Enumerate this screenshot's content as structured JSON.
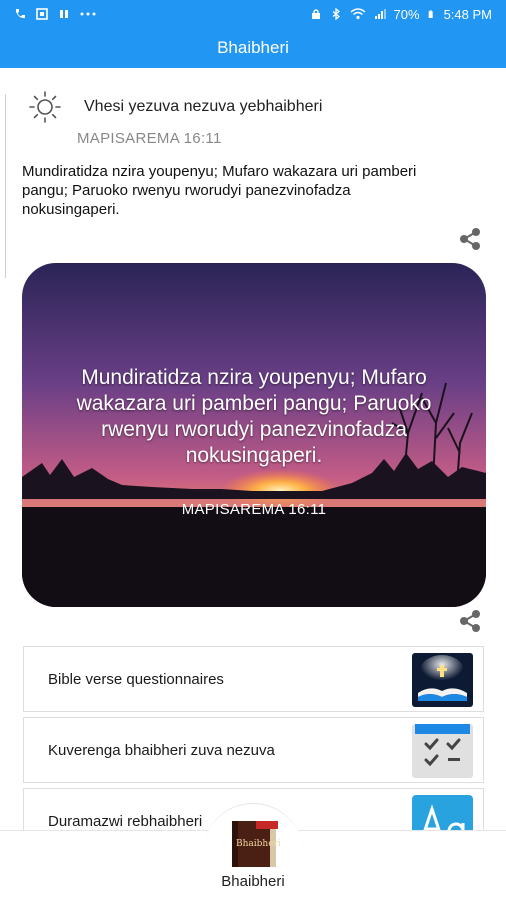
{
  "status_bar": {
    "battery": "70%",
    "time": "5:48 PM",
    "left_icons": [
      "phone-icon",
      "image-icon",
      "pause-icon",
      "more-icon"
    ],
    "right_icons": [
      "lock-icon",
      "bluetooth-icon",
      "wifi-icon",
      "signal-icon",
      "battery-icon"
    ]
  },
  "app_bar": {
    "title": "Bhaibheri",
    "color": "#2196f3"
  },
  "verse_of_day": {
    "title": "Vhesi yezuva nezuva yebhaibheri",
    "reference": "MAPISAREMA 16:11",
    "text": "Mundiratidza nzira youpenyu; Mufaro wakazara uri pamberi pangu; Paruoko rwenyu rworudyi panezvinofadza nokusingaperi."
  },
  "verse_card": {
    "text": "Mundiratidza nzira youpenyu; Mufaro wakazara uri pamberi pangu; Paruoko rwenyu rworudyi panezvinofadza nokusingaperi.",
    "reference": "MAPISAREMA 16:11"
  },
  "list": [
    {
      "label": "Bible verse questionnaires",
      "icon": "open-bible-icon"
    },
    {
      "label": "Kuverenga bhaibheri zuva nezuva",
      "icon": "checklist-calendar-icon"
    },
    {
      "label": "Duramazwi rebhaibheri",
      "icon": "font-aa-icon"
    }
  ],
  "bottom_nav": {
    "label": "Bhaibheri",
    "icon_text": "Bhaibheri"
  }
}
